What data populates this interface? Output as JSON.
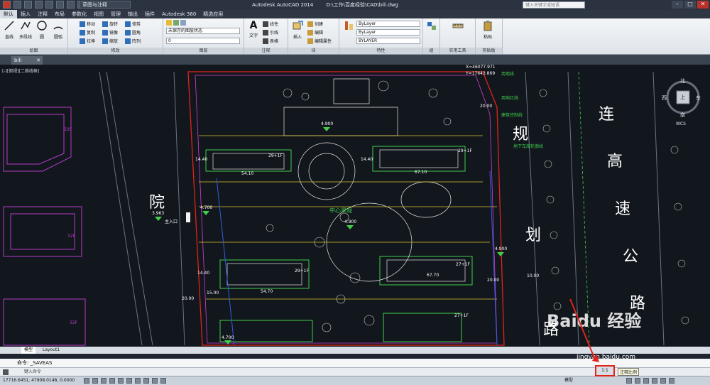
{
  "window": {
    "title_app": "Autodesk AutoCAD 2014",
    "title_path": "D:\\工作\\百度经验\\CAD\\bili.dwg",
    "workspace": "草图与注释",
    "search_placeholder": "键入关键字或短语",
    "controls": [
      "–",
      "□",
      "✕"
    ]
  },
  "menu": {
    "tabs": [
      "默认",
      "插入",
      "注释",
      "布局",
      "参数化",
      "视图",
      "管理",
      "输出",
      "插件",
      "Autodesk 360",
      "精选应用"
    ],
    "active": "默认"
  },
  "ribbon": {
    "draw": {
      "title": "绘图",
      "tools": [
        "直线",
        "多段线",
        "圆",
        "圆弧"
      ]
    },
    "modify": {
      "title": "修改",
      "rows": [
        [
          "移动",
          "旋转",
          "修剪"
        ],
        [
          "复制",
          "镜像",
          "圆角"
        ],
        [
          "拉伸",
          "缩放",
          "阵列"
        ]
      ]
    },
    "layers": {
      "title": "图层",
      "combo1": "未保存的图层状态",
      "combo2": "0"
    },
    "annotation": {
      "title": "注释",
      "big": "文字",
      "rows": [
        "线性",
        "引线",
        "表格"
      ]
    },
    "block": {
      "title": "块",
      "big": "插入",
      "rows": [
        "创建",
        "编辑",
        "编辑属性"
      ]
    },
    "properties": {
      "title": "特性",
      "big": "特性匹配",
      "combos": [
        "ByLayer",
        "ByLayer",
        "BYLAYER"
      ]
    },
    "groups": {
      "title": "组",
      "big": "组"
    },
    "utilities": {
      "title": "实用工具",
      "big": "测量"
    },
    "clipboard": {
      "title": "剪贴板",
      "big": "粘贴"
    }
  },
  "document": {
    "tab": "bili",
    "tab_close": "✕"
  },
  "viewport": {
    "label": "[-][俯视][二维线框]"
  },
  "viewcube": {
    "north": "北",
    "south": "南",
    "east": "东",
    "west": "西",
    "center": "上",
    "wcs": "WCS"
  },
  "drawing": {
    "labels_white": [
      "连",
      "高",
      "速",
      "公",
      "路",
      "规",
      "划",
      "院",
      "路"
    ],
    "levels": [
      "4.900",
      "4.700",
      "4.900",
      "4.900",
      "4.700"
    ],
    "spot_elev": "3.963",
    "entrance": "主入口",
    "center": "中心景观",
    "dims": [
      "54.10",
      "67.10",
      "54.70",
      "67.70",
      "14.40",
      "14.40",
      "14.40",
      "20.00",
      "15.00",
      "20.00",
      "10.00",
      "20.00"
    ],
    "buildings": [
      "29+1F",
      "29+1F",
      "27+1F",
      "27+1F",
      "29+1F"
    ],
    "legend": [
      "用地线",
      "用地红线",
      "建筑控制线",
      "地下车库轮廓线"
    ],
    "coords": [
      "X=46077.971",
      "Y=17643.869"
    ],
    "grid_label_1": "32F",
    "grid_label_2": "32F",
    "grid_label_3": "32F"
  },
  "layout_tabs": [
    "模型",
    "Layout1"
  ],
  "command": {
    "history": "命令: _SAVEAS",
    "prompt": "键入命令"
  },
  "status": {
    "coords": "17716.6451, 47908.0148, 0.0000",
    "model_label": "模型",
    "annotation_scale": "1:1",
    "annotation_scale_tooltip": "注释比例"
  },
  "watermark": {
    "text": "Baidu 经验",
    "url": "jingyan.baidu.com"
  }
}
